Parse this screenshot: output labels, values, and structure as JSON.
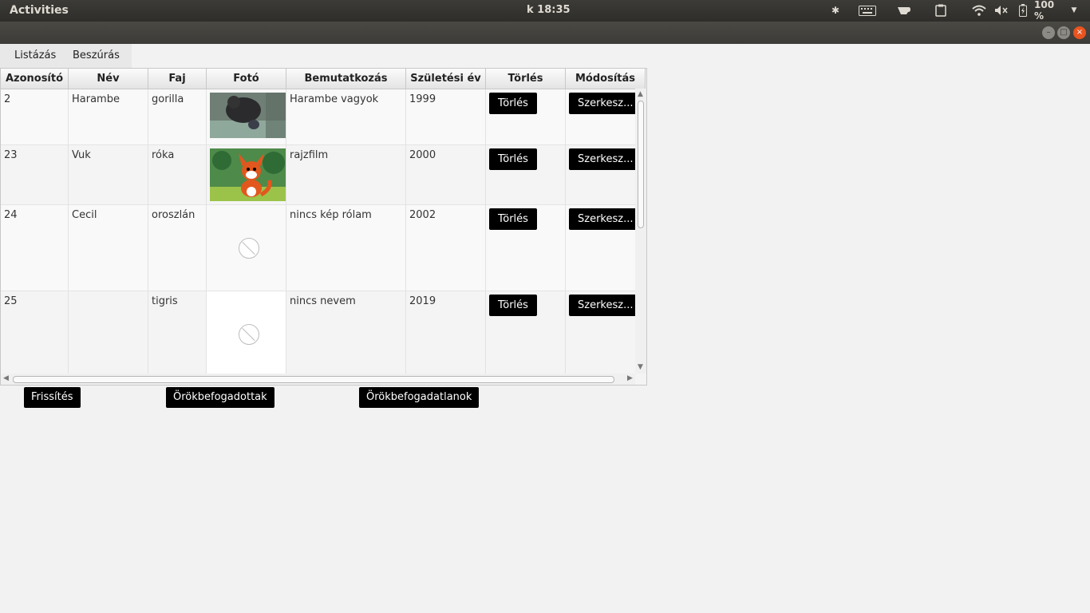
{
  "topbar": {
    "activities": "Activities",
    "clock": "k 18:35",
    "battery": "100 %"
  },
  "tabs": [
    "Listázás",
    "Beszúrás"
  ],
  "table": {
    "columns": [
      "Azonosító",
      "Név",
      "Faj",
      "Fotó",
      "Bemutatkozás",
      "Születési év",
      "Törlés",
      "Módosítás"
    ],
    "rows": [
      {
        "id": "2",
        "name": "Harambe",
        "species": "gorilla",
        "photo": "gorilla-photo",
        "intro": "Harambe vagyok",
        "year": "1999",
        "delete": "Törlés",
        "edit": "Szerkesz..."
      },
      {
        "id": "23",
        "name": "Vuk",
        "species": "róka",
        "photo": "fox-cartoon-photo",
        "intro": "rajzfilm",
        "year": "2000",
        "delete": "Törlés",
        "edit": "Szerkesz..."
      },
      {
        "id": "24",
        "name": "Cecil",
        "species": "oroszlán",
        "photo": "missing-image-icon",
        "intro": "nincs kép rólam",
        "year": "2002",
        "delete": "Törlés",
        "edit": "Szerkesz..."
      },
      {
        "id": "25",
        "name": "",
        "species": "tigris",
        "photo": "missing-image-icon",
        "intro": "nincs nevem",
        "year": "2019",
        "delete": "Törlés",
        "edit": "Szerkesz..."
      }
    ]
  },
  "buttons": {
    "refresh": "Frissítés",
    "adopted": "Örökbefogadottak",
    "not_adopted": "Örökbefogadatlanok"
  }
}
